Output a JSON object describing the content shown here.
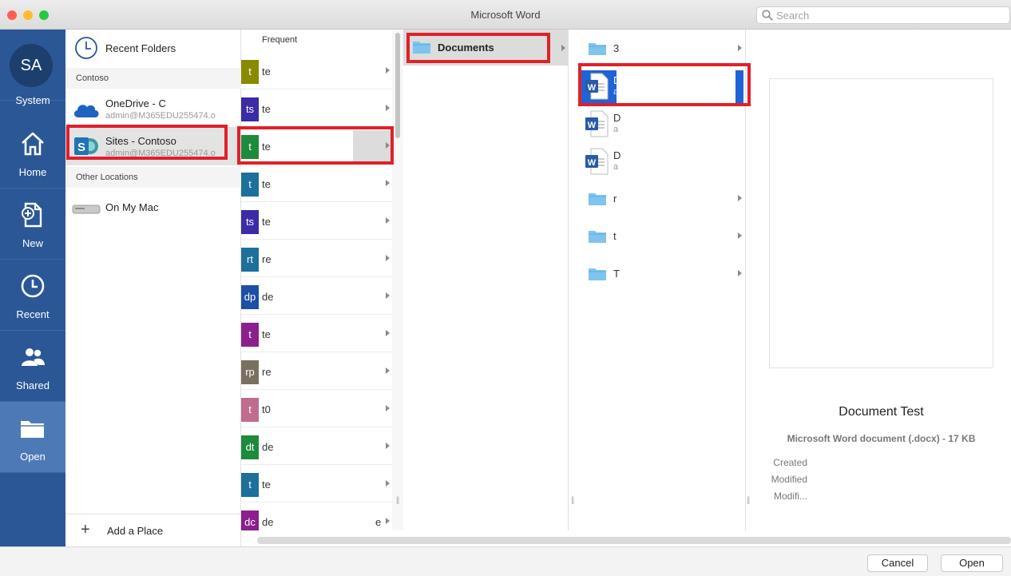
{
  "window": {
    "title": "Microsoft Word",
    "search_placeholder": "Search"
  },
  "left_nav": {
    "user_initials": "SA",
    "items": [
      {
        "label": "System",
        "icon": "avatar"
      },
      {
        "label": "Home",
        "icon": "home-icon"
      },
      {
        "label": "New",
        "icon": "new-document-icon"
      },
      {
        "label": "Recent",
        "icon": "clock-icon"
      },
      {
        "label": "Shared",
        "icon": "people-icon"
      },
      {
        "label": "Open",
        "icon": "folder-icon",
        "selected": true
      }
    ]
  },
  "places": {
    "recent_folders": "Recent Folders",
    "section_contoso": "Contoso",
    "onedrive_title": "OneDrive - C",
    "onedrive_sub": "admin@M365EDU255474.o",
    "sites_title": "Sites - Contoso",
    "sites_sub": "admin@M365EDU255474.o",
    "section_other": "Other Locations",
    "on_my_mac": "On My Mac",
    "add_place": "Add a Place"
  },
  "frequent": {
    "header": "Frequent",
    "items": [
      {
        "tile": "t",
        "name": "te",
        "color": "#8a8a00"
      },
      {
        "tile": "ts",
        "name": "te",
        "color": "#3a2ba6"
      },
      {
        "tile": "t",
        "name": "te",
        "color": "#1e8a3c",
        "selected": true
      },
      {
        "tile": "t",
        "name": "te",
        "color": "#1d6f9c"
      },
      {
        "tile": "ts",
        "name": "te",
        "color": "#3a2ba6"
      },
      {
        "tile": "rt",
        "name": "re",
        "color": "#1d6f9c"
      },
      {
        "tile": "dp",
        "name": "de",
        "color": "#1d4fa6"
      },
      {
        "tile": "t",
        "name": "te",
        "color": "#8b1f8e"
      },
      {
        "tile": "rp",
        "name": "re",
        "color": "#7a7060"
      },
      {
        "tile": "t",
        "name": "t0",
        "color": "#c06b90"
      },
      {
        "tile": "dt",
        "name": "de",
        "color": "#1e8a3c"
      },
      {
        "tile": "t",
        "name": "te",
        "color": "#1d6f9c"
      },
      {
        "tile": "dc",
        "name": "de",
        "color": "#8b1f8e",
        "suffix": "e"
      }
    ]
  },
  "column2": {
    "items": [
      {
        "name": "Documents"
      }
    ]
  },
  "column3": {
    "items": [
      {
        "type": "folder",
        "name": "3",
        "sub": ""
      },
      {
        "type": "word",
        "name": "D",
        "sub": "a",
        "selected": true
      },
      {
        "type": "word",
        "name": "D",
        "sub": "a"
      },
      {
        "type": "word",
        "name": "D",
        "sub": "a"
      },
      {
        "type": "folder",
        "name": "r",
        "sub": ""
      },
      {
        "type": "folder",
        "name": "t",
        "sub": ""
      },
      {
        "type": "folder",
        "name": "T",
        "sub": ""
      }
    ]
  },
  "preview": {
    "title": "Document Test",
    "type": "Microsoft Word document (.docx) - 17 KB",
    "created_label": "Created",
    "modified_label": "Modified",
    "modified_by_label": "Modifi..."
  },
  "buttons": {
    "cancel": "Cancel",
    "open": "Open"
  },
  "colors": {
    "nav_bg": "#2b5797",
    "nav_selected": "#4d79b6",
    "highlight_red": "#e0202a",
    "selection_blue": "#1f63d6"
  }
}
